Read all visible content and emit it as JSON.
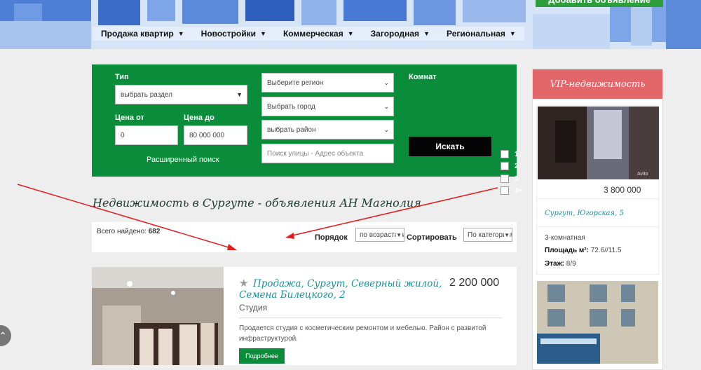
{
  "header": {
    "add_button_label": "Добавить объявление",
    "nav": [
      {
        "label": "Продажа квартир"
      },
      {
        "label": "Новостройки"
      },
      {
        "label": "Коммерческая"
      },
      {
        "label": "Загородная"
      },
      {
        "label": "Региональная"
      }
    ]
  },
  "search": {
    "type_label": "Тип",
    "type_value": "выбрать раздел",
    "price_from_label": "Цена от",
    "price_from_value": "0",
    "price_to_label": "Цена до",
    "price_to_value": "80 000 000",
    "advanced_label": "Расширенный поиск",
    "region_value": "Выберите регион",
    "city_value": "Выбрать город",
    "district_value": "выбрать район",
    "street_placeholder": "Поиск улицы - Адрес объекта",
    "rooms_label": "Комнат",
    "rooms": [
      "1",
      "2",
      "3",
      "4+"
    ],
    "find_label": "Искать"
  },
  "page_title": "Недвижимость в Сургуте - объявления АН Магнолия",
  "results": {
    "total_label": "Всего найдено:",
    "total_count": "682",
    "order_label": "Порядок",
    "order_value": "по возрастанию",
    "sort_label": "Сортировать",
    "sort_value": "По категориям"
  },
  "listing": {
    "title": "Продажа, Сургут, Северный жилой, Семена Билецкого, 2",
    "price": "2 200 000",
    "subtitle": "Студия",
    "description": "Продается студия с косметическим ремонтом и мебелью. Район с развитой инфраструктурой.",
    "more_label": "Подробнее"
  },
  "vip": {
    "heading": "VIP-недвижимость",
    "price": "3 800 000",
    "address": "Сургут, Югорская, 5",
    "rooms": "3-комнатная",
    "area_label": "Площадь м²:",
    "area_value": "72.6//11.5",
    "floor_label": "Этаж:",
    "floor_value": "8/9",
    "watermark": "Avito"
  },
  "colors": {
    "green": "#0b8c3b",
    "vip_red": "#e2676b",
    "link_teal": "#1c8f9a",
    "arrow_red": "#e02020"
  }
}
